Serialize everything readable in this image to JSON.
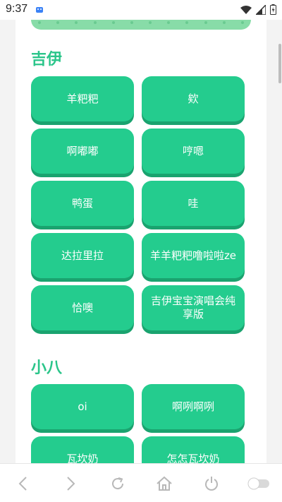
{
  "status": {
    "time": "9:37"
  },
  "sections": [
    {
      "title": "吉伊",
      "buttons": [
        "羊粑粑",
        "欸",
        "啊嘟嘟",
        "哼嗯",
        "鸭蛋",
        "哇",
        "达拉里拉",
        "羊羊粑粑噜啦啦ze",
        "恰噢",
        "吉伊宝宝演唱会纯享版"
      ]
    },
    {
      "title": "小八",
      "buttons": [
        "oi",
        "啊咧啊咧",
        "瓦坎奶",
        "怎怎瓦坎奶"
      ]
    }
  ],
  "colors": {
    "accent": "#2bc58a",
    "button": "#24cc8e",
    "button_shadow": "#1aa36f",
    "top_bar": "#88dca8"
  },
  "nav": {
    "icons": [
      "back-icon",
      "forward-icon",
      "refresh-icon",
      "home-icon",
      "power-icon",
      "toggle-icon"
    ]
  }
}
